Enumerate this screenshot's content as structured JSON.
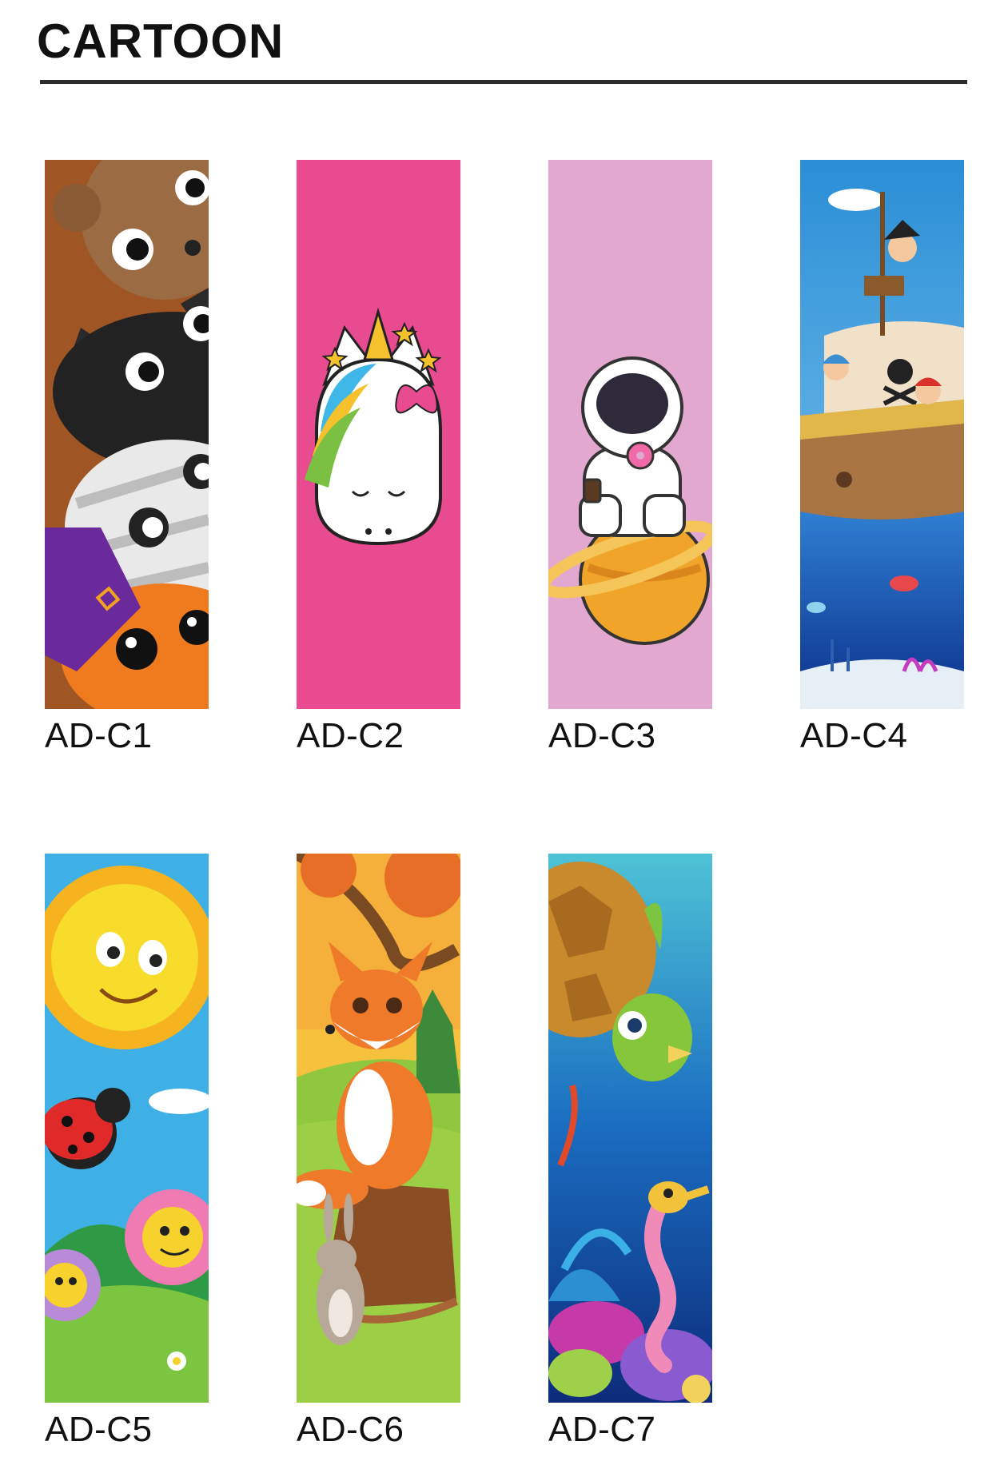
{
  "header": {
    "title": "CARTOON"
  },
  "items": [
    {
      "code": "AD-C1",
      "art": "peeking-animals-icon"
    },
    {
      "code": "AD-C2",
      "art": "unicorn-icon"
    },
    {
      "code": "AD-C3",
      "art": "astronaut-icon"
    },
    {
      "code": "AD-C4",
      "art": "pirate-ship-icon"
    },
    {
      "code": "AD-C5",
      "art": "sun-flowers-icon"
    },
    {
      "code": "AD-C6",
      "art": "fox-rabbit-icon"
    },
    {
      "code": "AD-C7",
      "art": "turtle-seahorse-icon"
    }
  ],
  "colors": {
    "c2_bg": "#e94b91",
    "c3_bg": "#e2a8d0",
    "rule": "#2b2b2b"
  }
}
